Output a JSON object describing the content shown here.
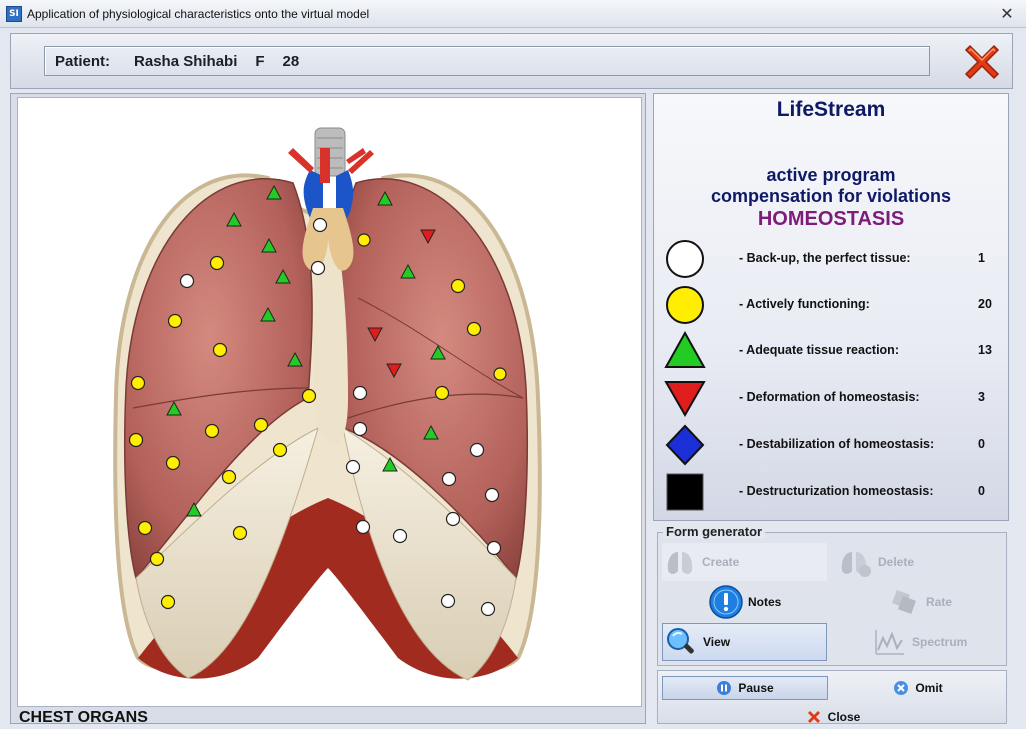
{
  "window": {
    "app_icon": "SI",
    "title": "Application of physiological characteristics onto the virtual model",
    "close_glyph": "✕"
  },
  "patient": {
    "label": "Patient:",
    "name": "Rasha Shihabi",
    "sex": "F",
    "age": "28"
  },
  "image_panel": {
    "organ_label": "CHEST ORGANS"
  },
  "legend": {
    "brand": "LifeStream",
    "line1": "active program",
    "line2": "compensation for violations",
    "line3": "HOMEOSTASIS",
    "items": [
      {
        "shape": "white-circle-icon",
        "color": "#ffffff",
        "label": "- Back-up, the perfect tissue:",
        "count": "1"
      },
      {
        "shape": "yellow-circle-icon",
        "color": "#ffee00",
        "label": "- Actively functioning:",
        "count": "20"
      },
      {
        "shape": "green-triangle-icon",
        "color": "#22cc22",
        "label": "- Adequate tissue reaction:",
        "count": "13"
      },
      {
        "shape": "red-inverted-triangle-icon",
        "color": "#e11c1c",
        "label": "- Deformation of homeostasis:",
        "count": "3"
      },
      {
        "shape": "blue-diamond-icon",
        "color": "#1a2fd6",
        "label": "- Destabilization of homeostasis:",
        "count": "0"
      },
      {
        "shape": "black-square-icon",
        "color": "#000000",
        "label": "- Destructurization homeostasis:",
        "count": "0"
      }
    ]
  },
  "form_generator": {
    "title": "Form generator",
    "buttons": {
      "create": "Create",
      "delete": "Delete",
      "notes": "Notes",
      "rate": "Rate",
      "view": "View",
      "spectrum": "Spectrum"
    }
  },
  "actions": {
    "pause": "Pause",
    "omit": "Omit",
    "close": "Close"
  }
}
